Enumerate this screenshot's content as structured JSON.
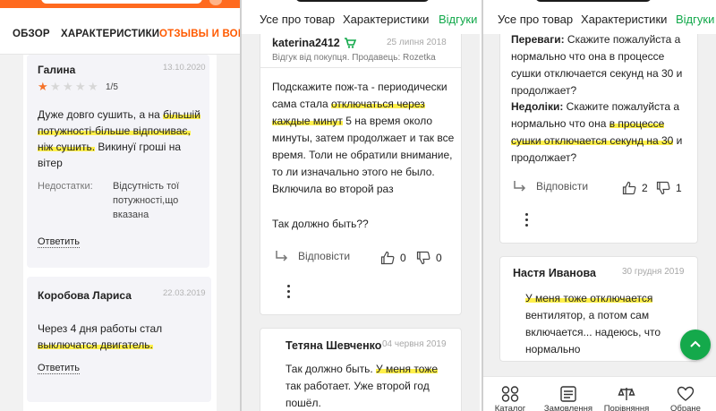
{
  "left": {
    "tabs": [
      "ОБЗОР",
      "ХАРАКТЕРИСТИКИ",
      "ОТЗЫВЫ И ВОПРОСЫ"
    ],
    "reviews": [
      {
        "name": "Галина",
        "date": "13.10.2020",
        "rating": 1,
        "rating_text": "1/5",
        "text_pre": "Дуже довго сушить, а на ",
        "text_hl": "більшій потужності-більше відпочиває, ніж сушить.",
        "text_post": " Викинуї гроші на вітер",
        "cons_label": "Недостатки:",
        "cons_value": "Відсутність тої потужності,що вказана",
        "answer": "Ответить"
      },
      {
        "name": "Коробова Лариса",
        "date": "22.03.2019",
        "text_pre": "Через 4 дня работы стал ",
        "text_hl": "выключатся двигатель.",
        "answer": "Ответить"
      }
    ]
  },
  "middle": {
    "tabs": [
      "Усе про товар",
      "Характеристики",
      "Відгуки"
    ],
    "review": {
      "user": "katerina2412",
      "date": "25 липня 2018",
      "subtitle": "Відгук від покупця. Продавець: Rozetka",
      "text_pre": "Подскажите пож-та - периодически сама стала ",
      "text_hl": "отключаться через каждые минут",
      "text_post": " 5 на время около минуты, затем продолжает и так все время. Толи не обратили внимание, то ли изначально этого не было. Включила во второй раз",
      "question": "Так должно быть??",
      "reply_label": "Відповісти",
      "likes": "0",
      "dislikes": "0"
    },
    "reply": {
      "user": "Тетяна Шевченко",
      "date": "04 червня 2019",
      "text_pre": "Так должно быть. ",
      "text_hl": "У меня тоже",
      "text_post": " так работает. Уже второй год пошёл."
    }
  },
  "right": {
    "tabs": [
      "Усе про товар",
      "Характеристики",
      "Відгуки"
    ],
    "review": {
      "pros_label": "Переваги:",
      "pros_text": " Скажите пожалуйста а нормально что она в процессе сушки отключается секунд на 30 и продолжает?",
      "cons_label": "Недоліки:",
      "cons_pre": " Скажите пожалуйста а нормально что она ",
      "cons_hl": "в процессе сушки отключается секунд на 30",
      "cons_post": " и продолжает?",
      "reply_label": "Відповісти",
      "likes": "2",
      "dislikes": "1"
    },
    "reply": {
      "user": "Настя Иванова",
      "date": "30 грудня 2019",
      "text_hl": "У меня тоже отключается",
      "text_post": " вентилятор, а потом сам включается... надеюсь, что нормально"
    },
    "nav": [
      "Каталог",
      "Замовлення",
      "Порівняння",
      "Обране"
    ]
  },
  "colors": {
    "accent_orange": "#ff5a00",
    "accent_green": "#11a84a",
    "highlight": "#fff04a",
    "star_on": "#f5732a"
  },
  "icons": [
    "star-icon",
    "reply-arrow-icon",
    "thumbs-up-icon",
    "thumbs-down-icon",
    "more-vertical-icon",
    "catalog-grid-icon",
    "orders-list-icon",
    "compare-scales-icon",
    "favorite-heart-icon",
    "chevron-up-icon",
    "verified-buyer-icon"
  ]
}
